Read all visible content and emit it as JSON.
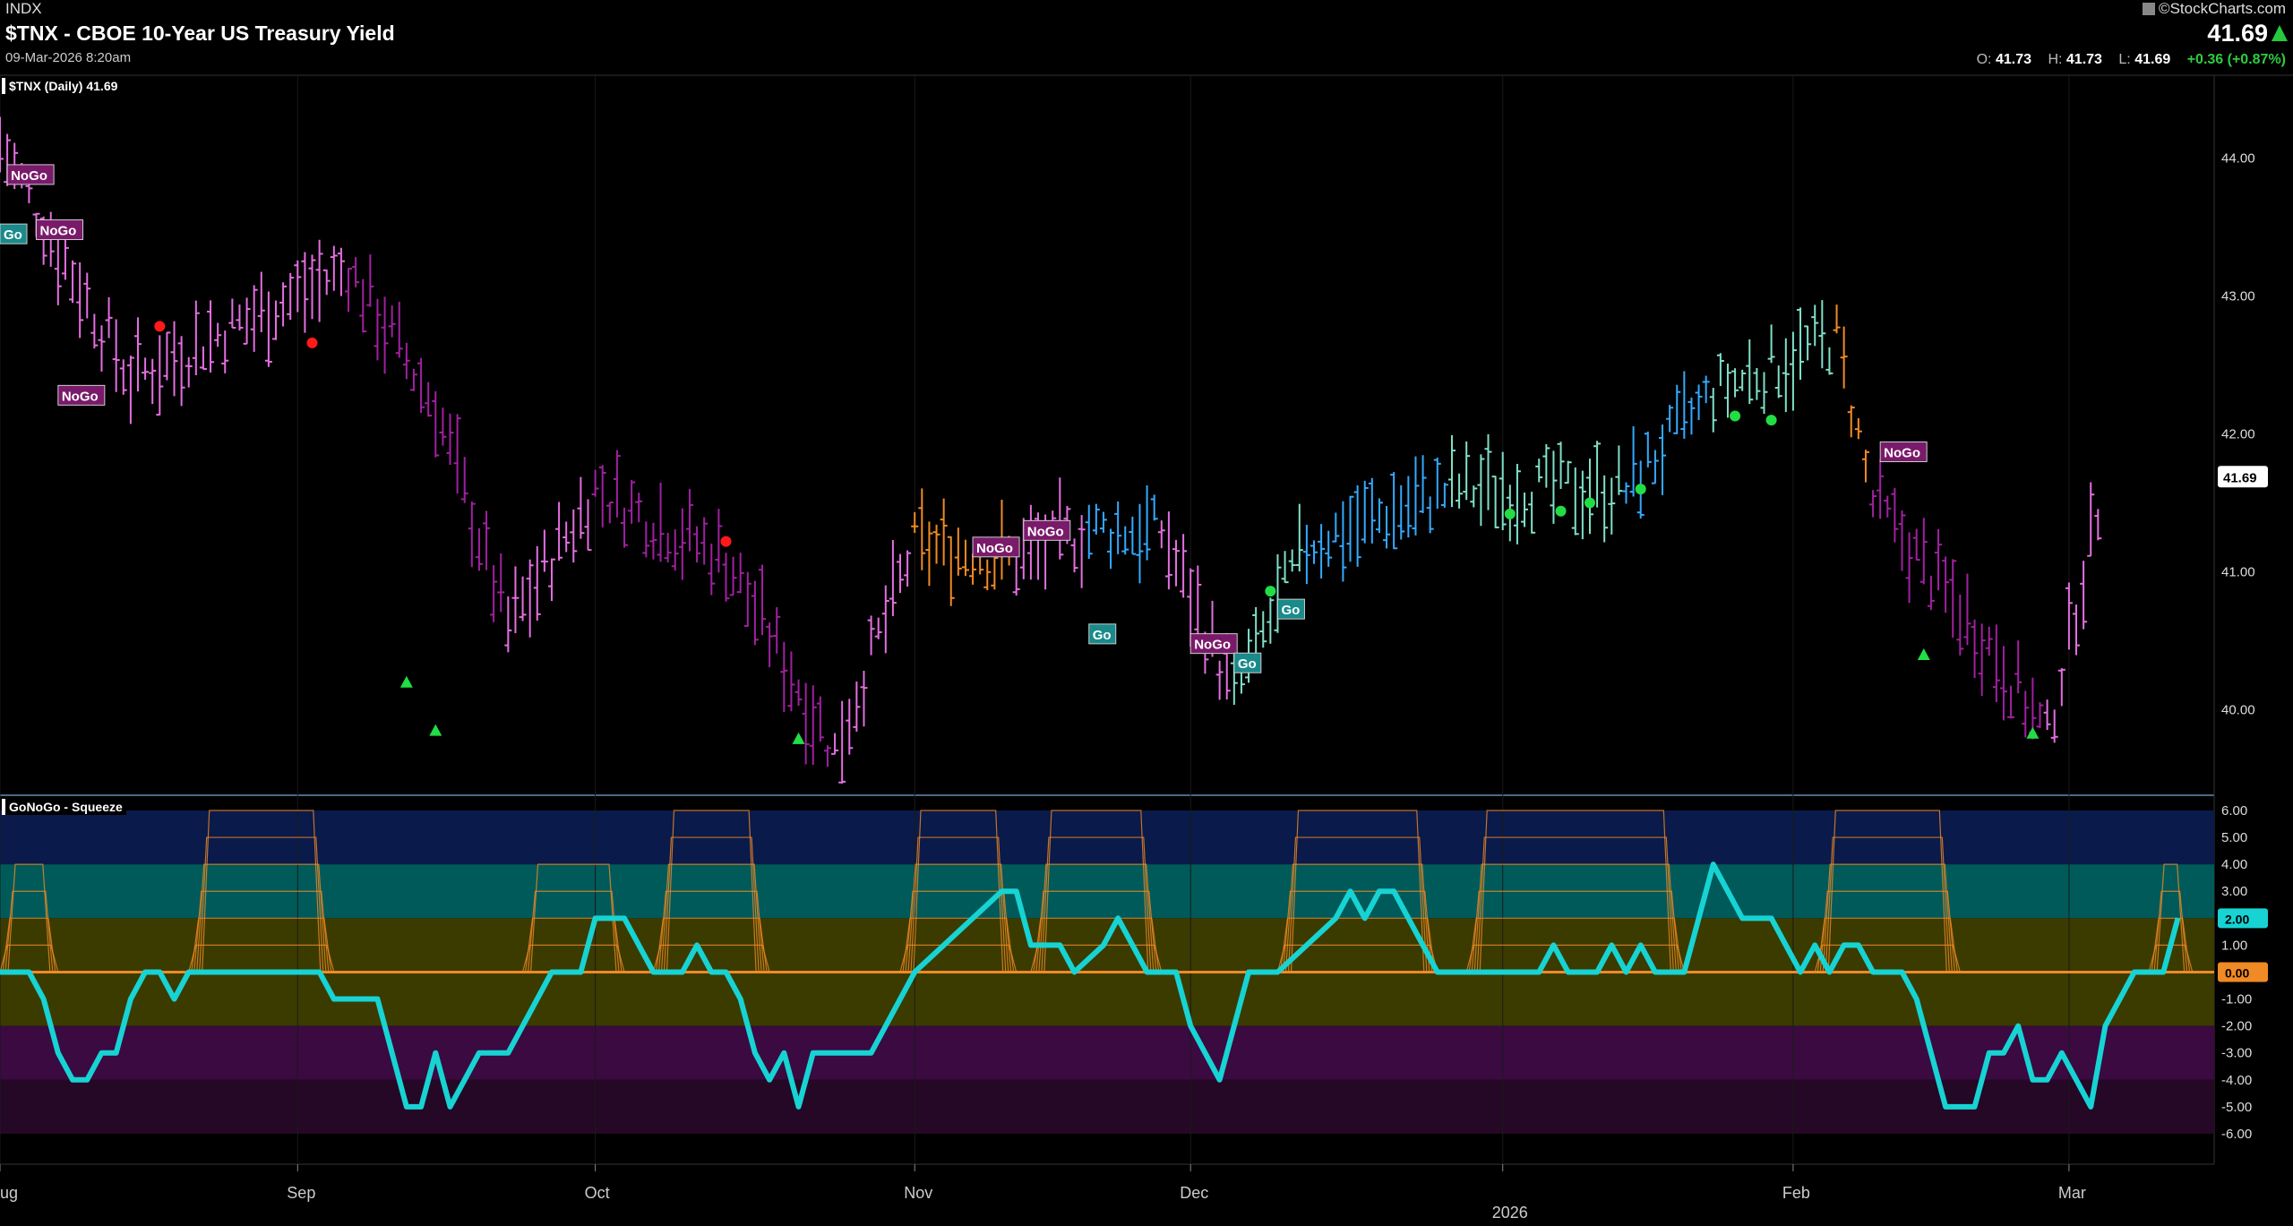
{
  "header": {
    "exchange": "INDX",
    "title": "$TNX - CBOE 10-Year US Treasury Yield",
    "date": "09-Mar-2026 8:20am",
    "brand": "©StockCharts.com",
    "last": "41.69",
    "ohlc": {
      "o_label": "O:",
      "o": "41.73",
      "h_label": "H:",
      "h": "41.73",
      "l_label": "L:",
      "l": "41.69",
      "change": "+0.36 (+0.87%)"
    }
  },
  "price_panel": {
    "label": "$TNX (Daily) 41.69",
    "current_price_tag": "41.69"
  },
  "oscillator_panel": {
    "label": "GoNoGo - Squeeze",
    "current_value_tag": "2.00",
    "zero_tag": "0.00"
  },
  "colors": {
    "go_strong": "#33aaff",
    "go_weak": "#7fe0c8",
    "nogo_strong": "#a020a0",
    "nogo_weak": "#e36fe0",
    "amber": "#f08a24",
    "oscillator": "#17d3d3",
    "squeeze": "#f08a24",
    "background": "#000000"
  },
  "chart_data": [
    {
      "type": "ohlc",
      "title": "$TNX (Daily) 41.69",
      "ylim": [
        39.4,
        44.6
      ],
      "y_ticks": [
        "44.00",
        "43.00",
        "42.00",
        "41.00",
        "40.00"
      ],
      "x_tick_labels": [
        "Aug",
        "Sep",
        "Oct",
        "Nov",
        "Dec",
        "2026",
        "Feb",
        "Mar"
      ],
      "x_tick_days": [
        0,
        41,
        82,
        126,
        164,
        207,
        247,
        285
      ],
      "n_days": 305,
      "segments": [
        {
          "x": [
            0,
            18
          ],
          "y": [
            44.1,
            42.4
          ],
          "color": "nogo_weak"
        },
        {
          "x": [
            18,
            48
          ],
          "y": [
            42.4,
            43.2
          ],
          "color": "nogo_weak"
        },
        {
          "x": [
            48,
            60
          ],
          "y": [
            43.2,
            42.2
          ],
          "color": "nogo_strong"
        },
        {
          "x": [
            60,
            70
          ],
          "y": [
            42.2,
            40.6
          ],
          "color": "nogo_strong"
        },
        {
          "x": [
            70,
            82
          ],
          "y": [
            40.6,
            41.6
          ],
          "color": "nogo_weak"
        },
        {
          "x": [
            82,
            100
          ],
          "y": [
            41.6,
            41.1
          ],
          "color": "nogo_strong"
        },
        {
          "x": [
            100,
            115
          ],
          "y": [
            41.1,
            39.7
          ],
          "color": "nogo_strong"
        },
        {
          "x": [
            115,
            126
          ],
          "y": [
            39.7,
            41.2
          ],
          "color": "nogo_weak"
        },
        {
          "x": [
            126,
            140
          ],
          "y": [
            41.2,
            41.1
          ],
          "color": "amber"
        },
        {
          "x": [
            140,
            150
          ],
          "y": [
            41.1,
            41.3
          ],
          "color": "nogo_weak"
        },
        {
          "x": [
            150,
            160
          ],
          "y": [
            41.3,
            41.3
          ],
          "color": "go_strong"
        },
        {
          "x": [
            160,
            170
          ],
          "y": [
            41.3,
            40.1
          ],
          "color": "nogo_weak"
        },
        {
          "x": [
            170,
            180
          ],
          "y": [
            40.1,
            41.2
          ],
          "color": "go_weak"
        },
        {
          "x": [
            180,
            200
          ],
          "y": [
            41.2,
            41.6
          ],
          "color": "go_strong"
        },
        {
          "x": [
            200,
            224
          ],
          "y": [
            41.6,
            41.6
          ],
          "color": "go_weak"
        },
        {
          "x": [
            224,
            236
          ],
          "y": [
            41.6,
            42.3
          ],
          "color": "go_strong"
        },
        {
          "x": [
            236,
            253
          ],
          "y": [
            42.3,
            42.7
          ],
          "color": "go_weak"
        },
        {
          "x": [
            253,
            258
          ],
          "y": [
            42.7,
            41.5
          ],
          "color": "amber"
        },
        {
          "x": [
            258,
            275
          ],
          "y": [
            41.5,
            40.4
          ],
          "color": "nogo_strong"
        },
        {
          "x": [
            275,
            282
          ],
          "y": [
            40.4,
            39.8
          ],
          "color": "nogo_strong"
        },
        {
          "x": [
            282,
            290
          ],
          "y": [
            39.8,
            41.69
          ],
          "color": "nogo_weak"
        }
      ],
      "labels": [
        {
          "text": "NoGo",
          "x": 1,
          "y": 43.88
        },
        {
          "text": "Go",
          "x": 0,
          "y": 43.45
        },
        {
          "text": "NoGo",
          "x": 5,
          "y": 43.48
        },
        {
          "text": "NoGo",
          "x": 8,
          "y": 42.28
        },
        {
          "text": "NoGo",
          "x": 134,
          "y": 41.18
        },
        {
          "text": "NoGo",
          "x": 141,
          "y": 41.3
        },
        {
          "text": "Go",
          "x": 150,
          "y": 40.55
        },
        {
          "text": "NoGo",
          "x": 164,
          "y": 40.48
        },
        {
          "text": "Go",
          "x": 170,
          "y": 40.34
        },
        {
          "text": "Go",
          "x": 176,
          "y": 40.73
        },
        {
          "text": "NoGo",
          "x": 259,
          "y": 41.87
        }
      ],
      "dots": [
        {
          "x": 22,
          "y": 42.78
        },
        {
          "x": 43,
          "y": 42.66
        },
        {
          "x": 100,
          "y": 41.22
        }
      ],
      "green_dots": [
        {
          "x": 175,
          "y": 40.86
        },
        {
          "x": 208,
          "y": 41.42
        },
        {
          "x": 215,
          "y": 41.44
        },
        {
          "x": 219,
          "y": 41.5
        },
        {
          "x": 226,
          "y": 41.6
        },
        {
          "x": 239,
          "y": 42.13
        },
        {
          "x": 244,
          "y": 42.1
        }
      ],
      "triangles": [
        {
          "x": 56,
          "y": 40.2
        },
        {
          "x": 60,
          "y": 39.85
        },
        {
          "x": 110,
          "y": 39.79
        },
        {
          "x": 265,
          "y": 40.4
        },
        {
          "x": 280,
          "y": 39.83
        }
      ]
    },
    {
      "type": "line",
      "title": "GoNoGo - Squeeze",
      "ylim": [
        -6.8,
        6.0
      ],
      "y_ticks": [
        "6.00",
        "5.00",
        "4.00",
        "3.00",
        "2.00",
        "1.00",
        "0.00",
        "-1.00",
        "-2.00",
        "-3.00",
        "-4.00",
        "-5.00",
        "-6.00"
      ],
      "zones": [
        {
          "from": 4,
          "to": 6,
          "color": "#0a1a4a"
        },
        {
          "from": 2,
          "to": 4,
          "color": "#005a5a"
        },
        {
          "from": 0,
          "to": 2,
          "color": "#3b3b00"
        },
        {
          "from": -2,
          "to": 0,
          "color": "#3b3b00"
        },
        {
          "from": -4,
          "to": -2,
          "color": "#3a0a40"
        },
        {
          "from": -6,
          "to": -4,
          "color": "#250826"
        }
      ],
      "series": [
        {
          "points": [
            [
              0,
              0
            ],
            [
              4,
              0
            ],
            [
              6,
              -1
            ],
            [
              8,
              -3
            ],
            [
              10,
              -4
            ],
            [
              12,
              -4
            ],
            [
              14,
              -3
            ],
            [
              16,
              -3
            ],
            [
              18,
              -1
            ],
            [
              20,
              0
            ],
            [
              22,
              0
            ],
            [
              24,
              -1
            ],
            [
              26,
              0
            ],
            [
              30,
              0
            ],
            [
              44,
              0
            ],
            [
              46,
              -1
            ],
            [
              52,
              -1
            ],
            [
              54,
              -3
            ],
            [
              56,
              -5
            ],
            [
              58,
              -5
            ],
            [
              60,
              -3
            ],
            [
              62,
              -5
            ],
            [
              64,
              -4
            ],
            [
              66,
              -3
            ],
            [
              70,
              -3
            ],
            [
              72,
              -2
            ],
            [
              74,
              -1
            ],
            [
              76,
              0
            ],
            [
              80,
              0
            ],
            [
              82,
              2
            ],
            [
              86,
              2
            ],
            [
              88,
              1
            ],
            [
              90,
              0
            ],
            [
              94,
              0
            ],
            [
              96,
              1
            ],
            [
              98,
              0
            ],
            [
              100,
              0
            ],
            [
              102,
              -1
            ],
            [
              104,
              -3
            ],
            [
              106,
              -4
            ],
            [
              108,
              -3
            ],
            [
              110,
              -5
            ],
            [
              112,
              -3
            ],
            [
              120,
              -3
            ],
            [
              122,
              -2
            ],
            [
              124,
              -1
            ],
            [
              126,
              0
            ],
            [
              130,
              1
            ],
            [
              134,
              2
            ],
            [
              138,
              3
            ],
            [
              140,
              3
            ],
            [
              142,
              1
            ],
            [
              146,
              1
            ],
            [
              148,
              0
            ],
            [
              152,
              1
            ],
            [
              154,
              2
            ],
            [
              158,
              0
            ],
            [
              162,
              0
            ],
            [
              164,
              -2
            ],
            [
              166,
              -3
            ],
            [
              168,
              -4
            ],
            [
              170,
              -2
            ],
            [
              172,
              0
            ],
            [
              176,
              0
            ],
            [
              180,
              1
            ],
            [
              184,
              2
            ],
            [
              186,
              3
            ],
            [
              188,
              2
            ],
            [
              190,
              3
            ],
            [
              192,
              3
            ],
            [
              196,
              1
            ],
            [
              198,
              0
            ],
            [
              212,
              0
            ],
            [
              214,
              1
            ],
            [
              216,
              0
            ],
            [
              220,
              0
            ],
            [
              222,
              1
            ],
            [
              224,
              0
            ],
            [
              226,
              1
            ],
            [
              228,
              0
            ],
            [
              232,
              0
            ],
            [
              236,
              4
            ],
            [
              240,
              2
            ],
            [
              244,
              2
            ],
            [
              246,
              1
            ],
            [
              248,
              0
            ],
            [
              250,
              1
            ],
            [
              252,
              0
            ],
            [
              254,
              1
            ],
            [
              256,
              1
            ],
            [
              258,
              0
            ],
            [
              262,
              0
            ],
            [
              264,
              -1
            ],
            [
              266,
              -3
            ],
            [
              268,
              -5
            ],
            [
              272,
              -5
            ],
            [
              274,
              -3
            ],
            [
              276,
              -3
            ],
            [
              278,
              -2
            ],
            [
              280,
              -4
            ],
            [
              282,
              -4
            ],
            [
              284,
              -3
            ],
            [
              286,
              -4
            ],
            [
              288,
              -5
            ],
            [
              290,
              -2
            ],
            [
              292,
              -1
            ],
            [
              294,
              0
            ],
            [
              298,
              0
            ],
            [
              300,
              2
            ]
          ],
          "color": "oscillator"
        }
      ],
      "squeeze_humps": [
        [
          0,
          8
        ],
        [
          26,
          46
        ],
        [
          72,
          86
        ],
        [
          90,
          106
        ],
        [
          124,
          140
        ],
        [
          142,
          160
        ],
        [
          176,
          198
        ],
        [
          202,
          232
        ],
        [
          250,
          270
        ],
        [
          296,
          302
        ]
      ]
    }
  ]
}
